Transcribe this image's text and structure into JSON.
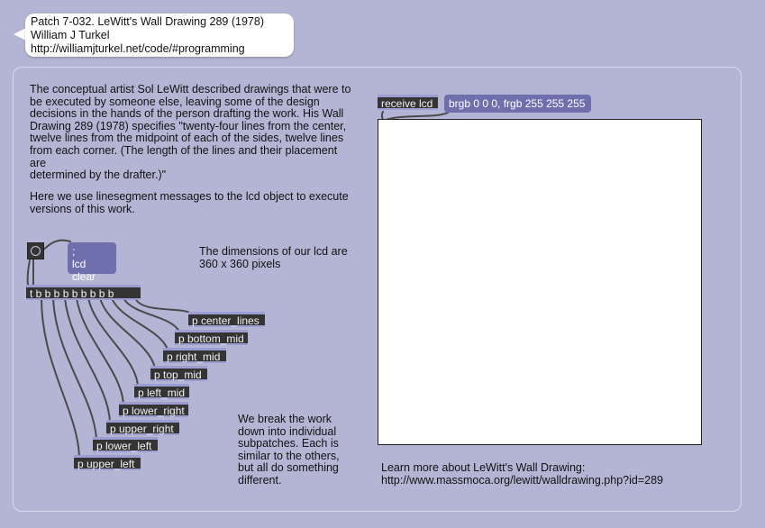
{
  "header": {
    "line1": "Patch 7-032. LeWitt's Wall Drawing 289 (1978)",
    "line2": "William J Turkel",
    "line3": "http://williamjturkel.net/code/#programming"
  },
  "comments": {
    "intro": "The conceptual artist Sol LeWitt described drawings that were to\nbe executed by someone else, leaving some of the design\ndecisions in the hands of the person drafting the work. His Wall\nDrawing 289 (1978) specifies \"twenty-four lines from the center,\ntwelve lines from the midpoint of each of the sides, twelve lines\nfrom each corner. (The length of the lines and their placement are\ndetermined by the drafter.)\"",
    "usage": "Here we use linesegment messages to the lcd object to execute\nversions of this work.",
    "dimensions": "The dimensions of our lcd are\n360 x 360 pixels",
    "subpatches": "We break the work\ndown into individual\nsubpatches. Each is\nsimilar to the others,\nbut all do something\ndifferent.",
    "learn_more": "Learn more about LeWitt's Wall Drawing:\nhttp://www.massmoca.org/lewitt/walldrawing.php?id=289"
  },
  "objects": {
    "trigger": "t b b b b b b b b b",
    "receive": "receive lcd",
    "center_lines": "p center_lines",
    "bottom_mid": "p bottom_mid",
    "right_mid": "p right_mid",
    "top_mid": "p top_mid",
    "left_mid": "p left_mid",
    "lower_right": "p lower_right",
    "upper_right": "p upper_right",
    "lower_left": "p lower_left",
    "upper_left": "p upper_left"
  },
  "messages": {
    "lcd_clear": ";\nlcd clear",
    "color": "brgb 0 0 0, frgb 255 255 255"
  },
  "colors": {
    "background": "#b4b5d5",
    "object_box": "#343434",
    "message_box": "#6f6fae",
    "cable": "#4a4a4a"
  }
}
